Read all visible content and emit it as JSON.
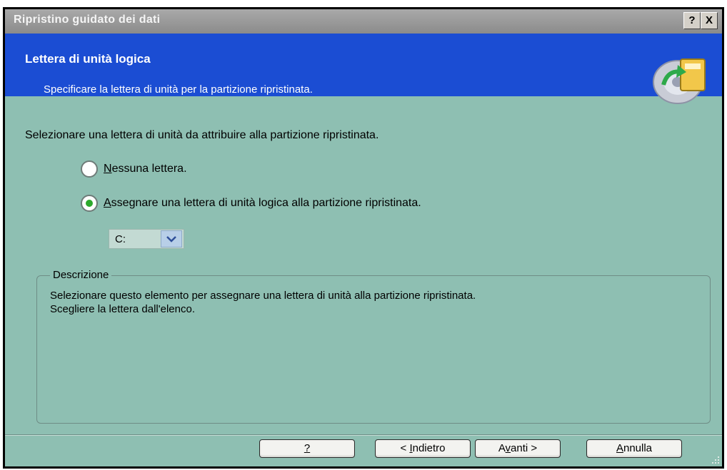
{
  "window": {
    "title": "Ripristino guidato dei dati",
    "help_button": "?",
    "close_button": "X"
  },
  "header": {
    "title": "Lettera di unità logica",
    "subtitle": "Specificare la lettera di unità per la partizione ripristinata."
  },
  "main": {
    "instruction": "Selezionare una lettera di unità da attribuire alla partizione ripristinata.",
    "options": [
      {
        "access_key": "N",
        "rest": "essuna lettera.",
        "checked": false
      },
      {
        "access_key": "A",
        "rest": "ssegnare una lettera di unità logica alla partizione ripristinata.",
        "checked": true
      }
    ],
    "drive_select": {
      "value": "C:"
    }
  },
  "description": {
    "legend": "Descrizione",
    "line1": "Selezionare questo elemento per assegnare una lettera di unità alla partizione ripristinata.",
    "line2": "Scegliere la lettera dall'elenco."
  },
  "buttons": {
    "help": {
      "label": "?"
    },
    "back": {
      "prefix": "< ",
      "key": "I",
      "rest": "ndietro"
    },
    "next": {
      "prefix": "A",
      "key": "v",
      "rest": "anti >"
    },
    "cancel": {
      "key": "A",
      "rest": "nnulla"
    }
  }
}
